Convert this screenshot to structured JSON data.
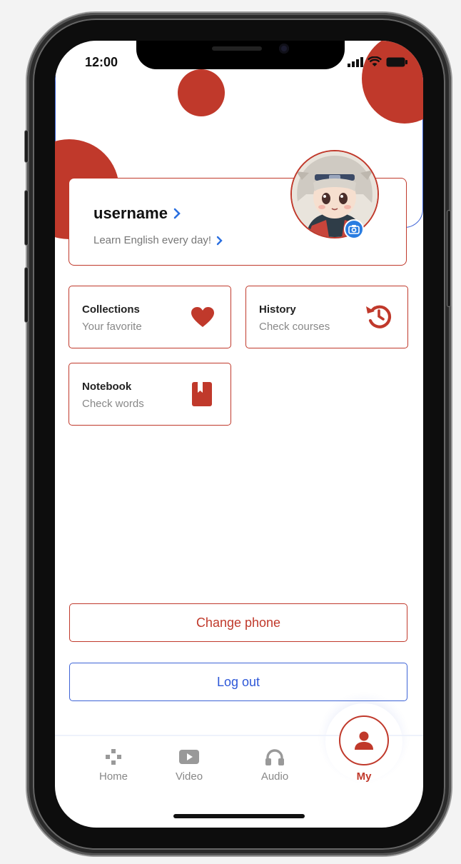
{
  "status_bar": {
    "time": "12:00"
  },
  "profile": {
    "username": "username",
    "motto": "Learn English every day!"
  },
  "cards": [
    {
      "title": "Collections",
      "subtitle": "Your favorite",
      "icon": "heart-icon"
    },
    {
      "title": "History",
      "subtitle": "Check courses",
      "icon": "history-icon"
    },
    {
      "title": "Notebook",
      "subtitle": "Check words",
      "icon": "bookmark-icon"
    }
  ],
  "buttons": {
    "change_phone": "Change phone",
    "log_out": "Log out"
  },
  "tabs": [
    {
      "label": "Home",
      "icon": "gamepad-icon"
    },
    {
      "label": "Video",
      "icon": "play-icon"
    },
    {
      "label": "Audio",
      "icon": "headphones-icon"
    },
    {
      "label": "My",
      "icon": "user-icon",
      "active": true
    }
  ],
  "colors": {
    "accent": "#c0392b",
    "link_blue": "#2e58d8",
    "badge_blue": "#2a7de1",
    "muted": "#888888"
  }
}
